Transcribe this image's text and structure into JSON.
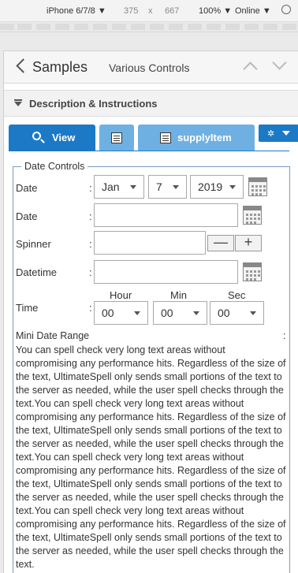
{
  "devtools": {
    "device": "iPhone 6/7/8 ▼",
    "width": "375",
    "sep": "x",
    "height": "667",
    "zoom": "100% ▼",
    "network": "Online ▼"
  },
  "nav": {
    "back_label": "Samples",
    "title": "Various Controls"
  },
  "description": {
    "label": "Description & Instructions"
  },
  "tabs": {
    "view": "View",
    "supply": "supplyItem"
  },
  "section": {
    "legend": "Date Controls"
  },
  "fields": {
    "date1_label": "Date",
    "date1_month": "Jan",
    "date1_day": "7",
    "date1_year": "2019",
    "date2_label": "Date",
    "spinner_label": "Spinner",
    "spinner_minus": "—",
    "spinner_plus": "+",
    "datetime_label": "Datetime",
    "time_label": "Time",
    "hour_label": "Hour",
    "min_label": "Min",
    "sec_label": "Sec",
    "hour_value": "00",
    "min_value": "00",
    "sec_value": "00",
    "colon": ":"
  },
  "mini_date_range": {
    "label": "Mini Date Range",
    "colon": ":"
  },
  "text_area": {
    "content": "You can spell check very long text areas without compromising any performance hits. Regardless of the size of the text, UltimateSpell only sends small portions of the text to the server as needed, while the user spell checks through the text.You can spell check very long text areas without compromising any performance hits. Regardless of the size of the text, UltimateSpell only sends small portions of the text to the server as needed, while the user spell checks through the text.You can spell check very long text areas without compromising any performance hits. Regardless of the size of the text, UltimateSpell only sends small portions of the text to the server as needed, while the user spell checks through the text.You can spell check very long text areas without compromising any performance hits. Regardless of the size of the text, UltimateSpell only sends small portions of the text to the server as needed, while the user spell checks through the text."
  },
  "colors": {
    "primary": "#1c79c6",
    "tab_light": "#6fb0e3",
    "fieldset_border": "#7a9bbf"
  }
}
